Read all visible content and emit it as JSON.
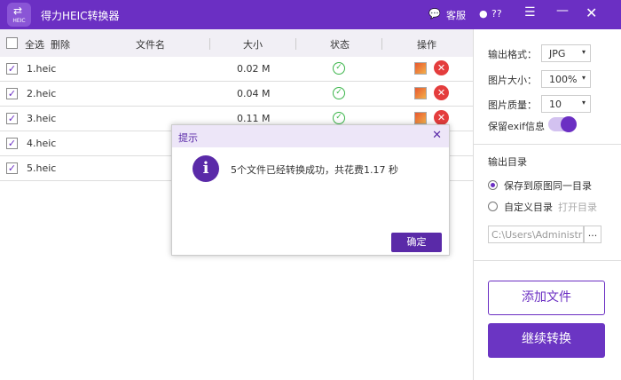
{
  "app": {
    "title": "得力HEIC转换器",
    "logo_text": "HEIC",
    "service": "客服",
    "user": "??"
  },
  "table": {
    "select_all": "全选",
    "delete": "删除",
    "headers": [
      "文件名",
      "大小",
      "状态",
      "操作"
    ],
    "rows": [
      {
        "name": "1.heic",
        "size": "0.02 M"
      },
      {
        "name": "2.heic",
        "size": "0.04 M"
      },
      {
        "name": "3.heic",
        "size": "0.11 M"
      },
      {
        "name": "4.heic",
        "size": ""
      },
      {
        "name": "5.heic",
        "size": ""
      }
    ]
  },
  "settings": {
    "format_label": "输出格式：",
    "format": "JPG",
    "size_label": "图片大小：",
    "size": "100%",
    "quality_label": "图片质量：",
    "quality": "10",
    "exif_label": "保留exif信息",
    "exif_on": true,
    "output_dir_title": "输出目录",
    "opt_same": "保存到原图同一目录",
    "opt_custom": "自定义目录",
    "open_dir": "打开目录",
    "path": "C:\\Users\\Administra",
    "browse": "..."
  },
  "buttons": {
    "add": "添加文件",
    "continue": "继续转换"
  },
  "dialog": {
    "title": "提示",
    "message": "5个文件已经转换成功，共花费1.17 秒",
    "ok": "确定"
  },
  "colors": {
    "accent": "#6b2fc3"
  }
}
